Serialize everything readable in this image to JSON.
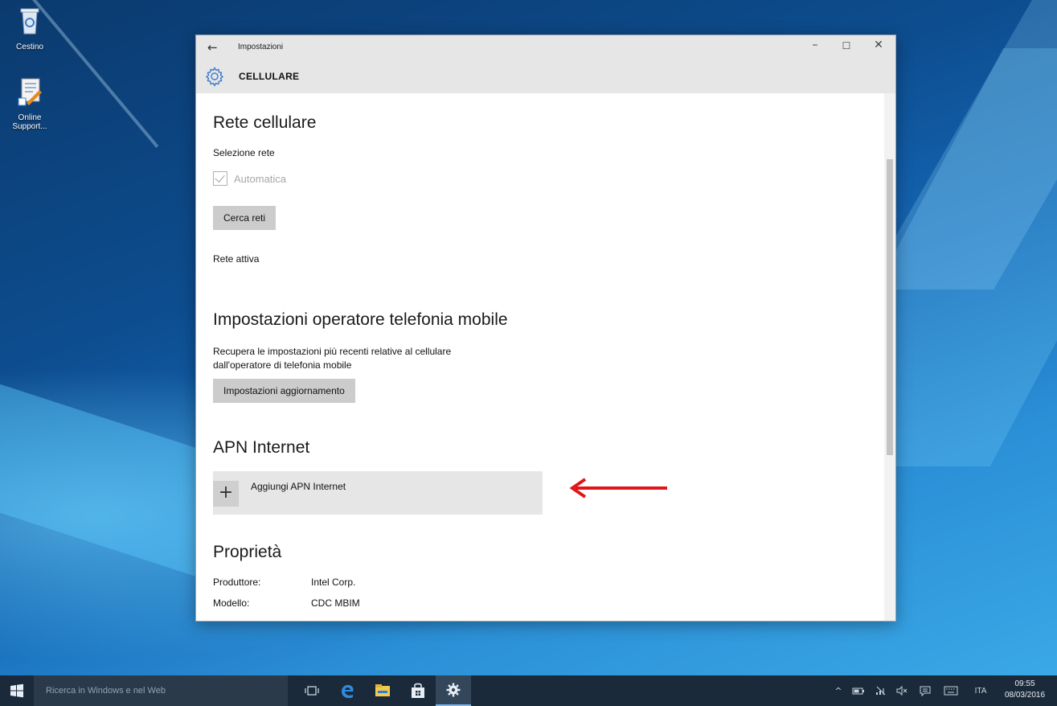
{
  "desktop": {
    "icons": [
      {
        "label": "Cestino"
      },
      {
        "label": "Online Support..."
      }
    ]
  },
  "window": {
    "titlebar": {
      "back_glyph": "←",
      "title": "Impostazioni",
      "minimize_glyph": "–",
      "maximize_glyph": "☐",
      "close_glyph": "✕"
    },
    "page_heading": "CELLULARE",
    "sections": {
      "network": {
        "heading": "Rete cellulare",
        "selection_label": "Selezione rete",
        "automatic_label": "Automatica",
        "automatic_checked": true,
        "search_button": "Cerca reti",
        "active_network_label": "Rete attiva"
      },
      "operator": {
        "heading": "Impostazioni operatore telefonia mobile",
        "description_line1": "Recupera le impostazioni più recenti relative al cellulare",
        "description_line2": "dall'operatore di telefonia mobile",
        "update_button": "Impostazioni aggiornamento"
      },
      "apn": {
        "heading": "APN Internet",
        "plus_glyph": "+",
        "add_label": "Aggiungi APN Internet"
      },
      "properties": {
        "heading": "Proprietà",
        "rows": [
          {
            "key": "Produttore:",
            "value": "Intel Corp."
          },
          {
            "key": "Modello:",
            "value": "CDC MBIM"
          }
        ]
      }
    },
    "annotation_arrow_color": "#e0161b"
  },
  "taskbar": {
    "search_placeholder": "Ricerca in Windows e nel Web",
    "tray": {
      "chevron": "^",
      "language": "ITA",
      "time": "09:55",
      "date": "08/03/2016"
    }
  }
}
